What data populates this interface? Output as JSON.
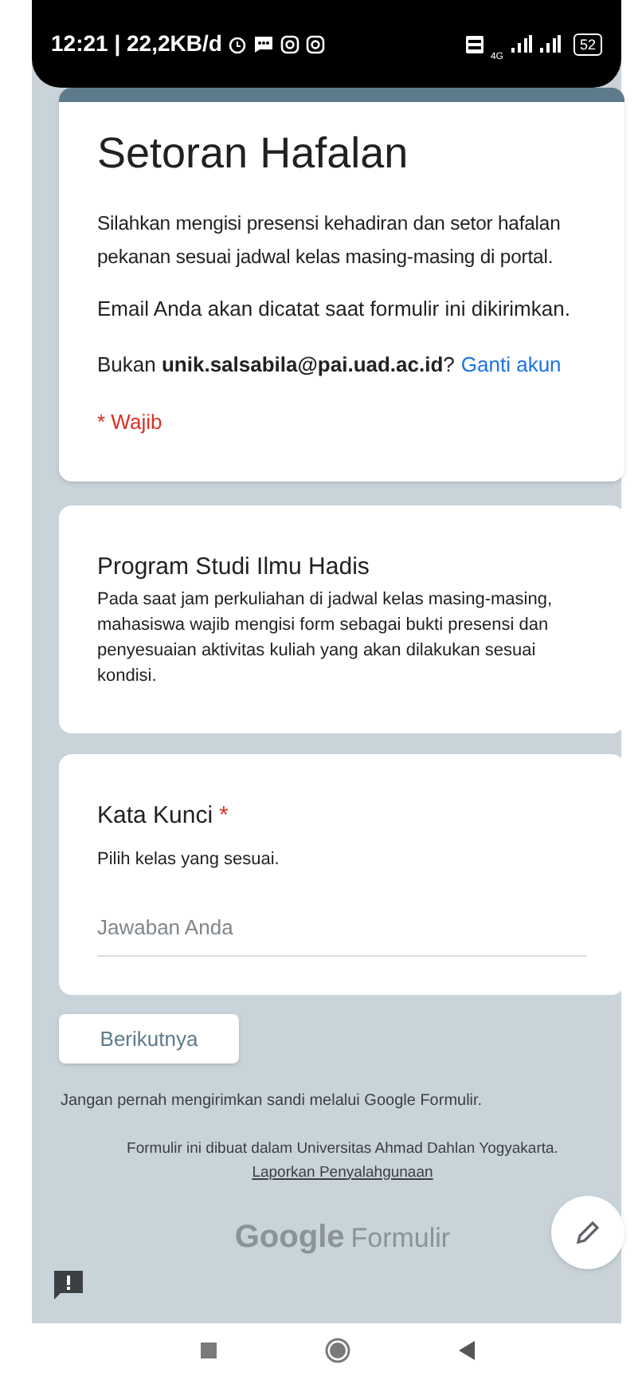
{
  "status_bar": {
    "time": "12:21 | 22,2KB/d",
    "battery": "52",
    "network": "4G"
  },
  "form": {
    "title": "Setoran Hafalan",
    "description": "Silahkan mengisi presensi kehadiran dan setor hafalan pekanan sesuai jadwal kelas masing-masing di portal.",
    "email_notice": "Email Anda akan dicatat saat formulir ini dikirimkan.",
    "account_line": "Bukan **unik.salsabila@pai.uad.ac.id**?",
    "switch_account": "Ganti akun",
    "required_note": "* Wajib"
  },
  "section": {
    "title": "Program Studi Ilmu Hadis",
    "description": "Pada saat jam perkuliahan di jadwal kelas masing-masing, mahasiswa wajib mengisi form sebagai bukti presensi dan penyesuaian aktivitas kuliah yang akan dilakukan sesuai kondisi."
  },
  "question": {
    "title": "Kata Kunci",
    "required": true,
    "required_mark": "*",
    "help": "Pilih kelas yang sesuai.",
    "placeholder": "Jawaban Anda"
  },
  "next_button": "Berikutnya",
  "password_warning": "Jangan pernah mengirimkan sandi melalui Google Formulir.",
  "footer": {
    "created_by": "Formulir ini dibuat dalam Universitas Ahmad Dahlan Yogyakarta.",
    "report_link": "Laporkan Penyalahgunaan",
    "logo_brand": "Google",
    "logo_product": "Formulir"
  }
}
